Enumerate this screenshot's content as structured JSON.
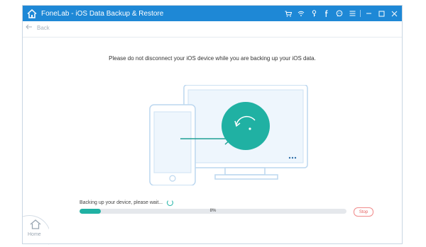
{
  "app": {
    "title": "FoneLab - iOS Data Backup & Restore",
    "accent": "#1e88d6",
    "titlebar_icons": [
      "cart-icon",
      "wifi-icon",
      "key-icon",
      "facebook-icon",
      "chat-icon",
      "menu-icon",
      "minimize-icon",
      "maximize-icon",
      "close-icon"
    ]
  },
  "toolbar": {
    "back_label": "Back"
  },
  "main": {
    "message": "Please do not disconnect your iOS device while you are backing up your iOS data."
  },
  "progress": {
    "label": "Backing up your device, please wait...",
    "percent_text": "8%",
    "value": 0.08,
    "stop_label": "Stop",
    "fill_color": "#20b1a3"
  },
  "home": {
    "label": "Home"
  }
}
